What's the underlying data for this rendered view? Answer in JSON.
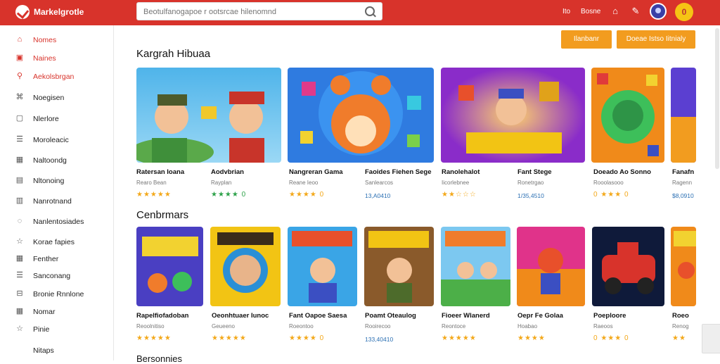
{
  "topbar": {
    "brand": "Markelgrotle",
    "search_placeholder": "Beotulfanogapoe r ootsrcae hilenomnd",
    "links": [
      "Ito",
      "Bosne"
    ],
    "coin_label": "0"
  },
  "sidebar": {
    "items": [
      {
        "label": "Nomes",
        "icon": "home-icon",
        "active": true
      },
      {
        "label": "Naines",
        "icon": "store-icon",
        "active": true
      },
      {
        "label": "Aekolsbrgan",
        "icon": "search-icon",
        "active": true
      },
      {
        "label": "Noegisen",
        "icon": "chart-icon",
        "active": false
      },
      {
        "label": "Nlerlore",
        "icon": "box-icon",
        "active": false
      },
      {
        "label": "Moroleacic",
        "icon": "list-icon",
        "active": false
      },
      {
        "label": "Naltoondg",
        "icon": "grid-icon",
        "active": false
      },
      {
        "label": "Nltonoing",
        "icon": "book-icon",
        "active": false
      },
      {
        "label": "Nanrotnand",
        "icon": "folder-icon",
        "active": false
      },
      {
        "label": "Nanlentosiades",
        "icon": "tag-icon",
        "active": false
      },
      {
        "label": "Korae fapies",
        "icon": "star-outline-icon",
        "active": false
      },
      {
        "label": "Fenther",
        "icon": "grid-icon",
        "active": false
      },
      {
        "label": "Sanconang",
        "icon": "list-icon",
        "active": false
      },
      {
        "label": "Bronie Rnnlone",
        "icon": "ticket-icon",
        "active": false
      },
      {
        "label": "Nomar",
        "icon": "grid-icon",
        "active": false
      },
      {
        "label": "Pinie",
        "icon": "star-icon",
        "active": false
      },
      {
        "label": "Nitaps",
        "icon": "blank",
        "active": false
      }
    ]
  },
  "main": {
    "buttons": [
      "Ilanbanr",
      "Doeae Istso Iitnialy"
    ],
    "section1": {
      "title": "Kargrah Hibuaa",
      "cards": [
        {
          "title": "Ratersan Ioana",
          "sub": "Rearo Bean",
          "meta": "★★★★★",
          "meta_type": "stars"
        },
        {
          "title": "Aodvbrian",
          "sub": "Rayplan",
          "meta": "★★★★ 0",
          "meta_type": "green"
        },
        {
          "title": "Nangreran Gama",
          "sub": "Reane Ieoo",
          "meta": "★★★★ 0",
          "meta_type": "starsnum"
        },
        {
          "title": "Faoides Fiehen Sege",
          "sub": "Sanlearcos",
          "meta": "13,A0410",
          "meta_type": "text"
        },
        {
          "title": "Ranolehalot",
          "sub": "Iicorlebnee",
          "meta": "★★☆☆☆",
          "meta_type": "stars"
        },
        {
          "title": "Fant Stege",
          "sub": "Ronetrgao",
          "meta": "1/35,4510",
          "meta_type": "text"
        },
        {
          "title": "Doeado Ao Sonno",
          "sub": "Rooolasooo",
          "meta": "0 ★★★ 0",
          "meta_type": "starsnum"
        },
        {
          "title": "Fanafn",
          "sub": "Ragenn",
          "meta": "$8,0910",
          "meta_type": "text"
        }
      ]
    },
    "section2": {
      "title": "Cenbrmars",
      "cards": [
        {
          "title": "Rapelfiofadoban",
          "sub": "Reoolnitiso",
          "meta": "★★★★★",
          "meta_type": "stars"
        },
        {
          "title": "Oeonhtuaer Iunoc",
          "sub": "Geueeno",
          "meta": "★★★★★",
          "meta_type": "stars"
        },
        {
          "title": "Fant Oapoe Saesa",
          "sub": "Roeontoo",
          "meta": "★★★★ 0",
          "meta_type": "starsnum"
        },
        {
          "title": "Poamt Oteaulog",
          "sub": "Rooirecoo",
          "meta": "133,40410",
          "meta_type": "text"
        },
        {
          "title": "Fioeer Wlanerd",
          "sub": "Reontoce",
          "meta": "★★★★★",
          "meta_type": "stars"
        },
        {
          "title": "Oepr Fe Golaa",
          "sub": "Hoabao",
          "meta": "★★★★",
          "meta_type": "stars"
        },
        {
          "title": "Poeploore",
          "sub": "Raeoos",
          "meta": "0 ★★★ 0",
          "meta_type": "starsnum"
        },
        {
          "title": "Roeo",
          "sub": "Renog",
          "meta": "★★",
          "meta_type": "stars"
        }
      ]
    },
    "section3": {
      "title": "Bersonnies"
    }
  }
}
